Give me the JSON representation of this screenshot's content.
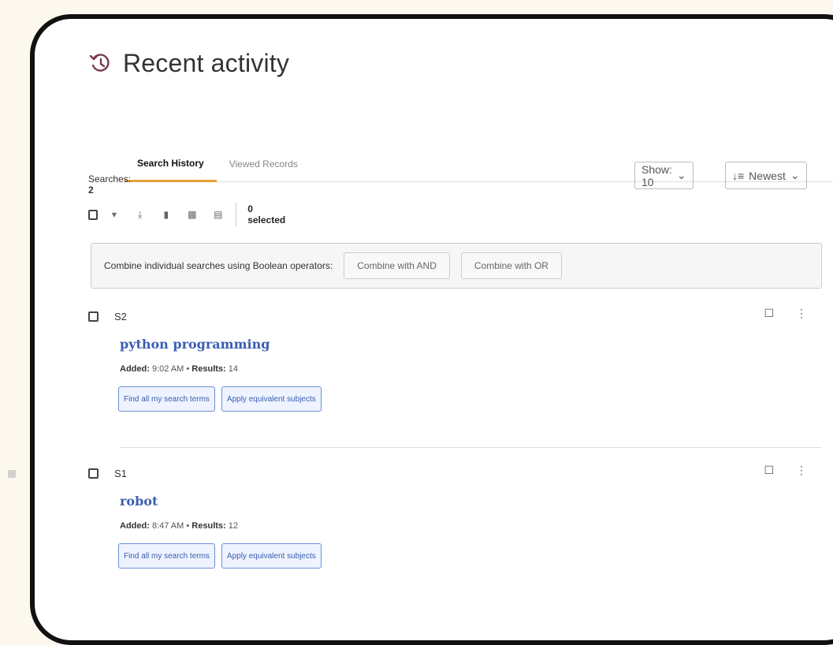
{
  "header": {
    "title": "Recent activity"
  },
  "tabs": [
    {
      "label": "Search History",
      "active": true
    },
    {
      "label": "Viewed Records",
      "active": false
    }
  ],
  "summary": {
    "label": "Searches:",
    "count": "2"
  },
  "controls": {
    "show_label": "Show: 10",
    "sort_label": "Newest"
  },
  "toolbar": {
    "selected_text": "0 selected",
    "icons": [
      "checkbox",
      "chevron-down-icon",
      "download-icon",
      "bookmark-icon",
      "folder-icon",
      "trash-icon"
    ]
  },
  "combine": {
    "label": "Combine individual searches using Boolean operators:",
    "and_label": "Combine with AND",
    "or_label": "Combine with OR"
  },
  "entries": [
    {
      "id": "S2",
      "query": "python programming",
      "added_label": "Added:",
      "added_time": "9:02 AM",
      "results_label": "Results:",
      "results": "14",
      "btn1": "Find all my search terms",
      "btn2": "Apply equivalent subjects"
    },
    {
      "id": "S1",
      "query": "robot",
      "added_label": "Added:",
      "added_time": "8:47 AM",
      "results_label": "Results:",
      "results": "12",
      "btn1": "Find all my search terms",
      "btn2": "Apply equivalent subjects"
    }
  ],
  "colors": {
    "accent_tab": "#e8a33b",
    "link": "#3a5eb0",
    "history_icon": "#7a3a4a"
  }
}
